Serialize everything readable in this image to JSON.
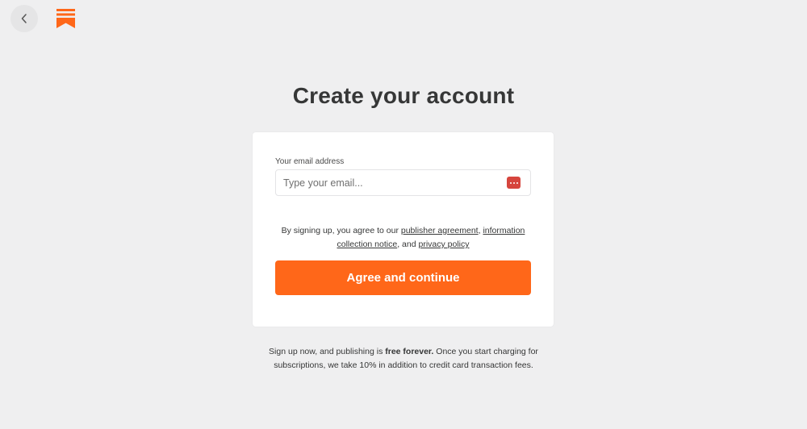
{
  "nav": {
    "back_icon": "chevron-left-icon",
    "logo_icon": "substack-logo-icon",
    "brand_color": "#ff6719"
  },
  "page": {
    "title": "Create your account"
  },
  "form": {
    "email_label": "Your email address",
    "email_placeholder": "Type your email...",
    "email_value": "",
    "autofill_icon": "password-manager-icon"
  },
  "terms": {
    "prefix": "By signing up, you agree to our ",
    "publisher_agreement": "publisher agreement",
    "sep1": ", ",
    "information_collection_notice": "information collection notice",
    "sep2": ", and ",
    "privacy_policy": "privacy policy"
  },
  "actions": {
    "agree_label": "Agree and continue"
  },
  "footer": {
    "line1_prefix": "Sign up now, and publishing is ",
    "line1_bold": "free forever.",
    "line1_suffix": " Once you start charging for",
    "line2": "subscriptions, we take 10% in addition to credit card transaction fees."
  }
}
